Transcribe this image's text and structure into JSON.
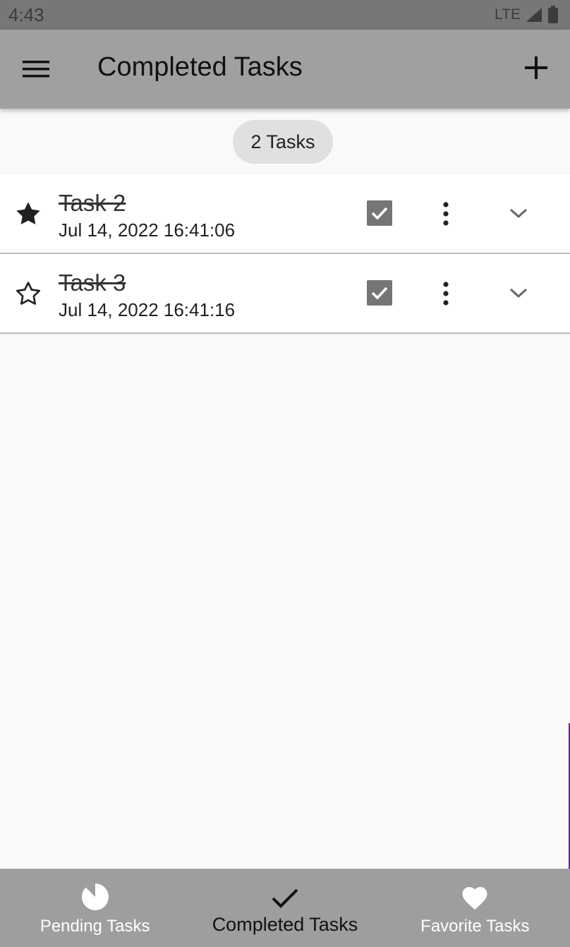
{
  "status_bar": {
    "time": "4:43",
    "network": "LTE",
    "signal_icon": "signal-icon",
    "battery_icon": "battery-icon"
  },
  "app_bar": {
    "title": "Completed Tasks",
    "menu_icon": "menu-icon",
    "add_icon": "add-icon"
  },
  "task_count": "2 Tasks",
  "tasks": [
    {
      "title": "Task 2",
      "date": "Jul 14, 2022 16:41:06",
      "favorite": true,
      "completed": true
    },
    {
      "title": "Task 3",
      "date": "Jul 14, 2022 16:41:16",
      "favorite": false,
      "completed": true
    }
  ],
  "bottom_nav": {
    "items": [
      {
        "label": "Pending Tasks",
        "icon": "pie-icon",
        "active": false
      },
      {
        "label": "Completed Tasks",
        "icon": "check-icon",
        "active": true
      },
      {
        "label": "Favorite Tasks",
        "icon": "heart-icon",
        "active": false
      }
    ]
  },
  "colors": {
    "app_bar": "#a0a0a0",
    "status_bar": "#777777",
    "bottom_nav": "#9e9e9e",
    "checkbox": "#757575",
    "background": "#f9f9f9"
  }
}
